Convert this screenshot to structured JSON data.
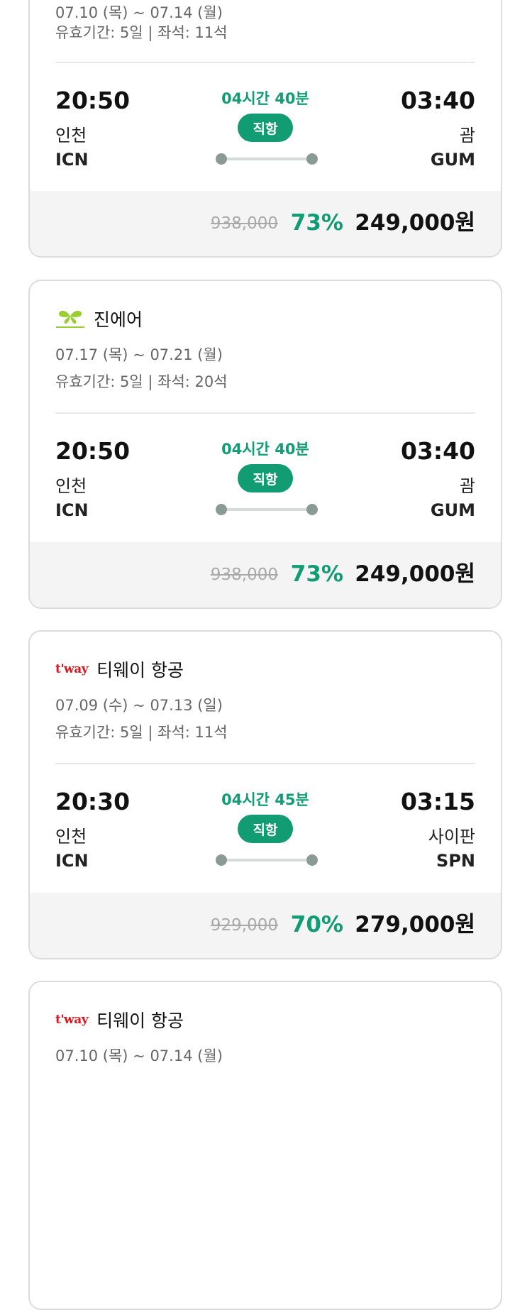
{
  "cards": [
    {
      "airline": "",
      "dates": "07.10 (목) ~ 07.14 (월)",
      "validity": "유효기간: 5일 | 좌석: 11석",
      "departure": {
        "time": "20:50",
        "city": "인천",
        "code": "ICN"
      },
      "arrival": {
        "time": "03:40",
        "city": "괌",
        "code": "GUM"
      },
      "duration": "04시간 40분",
      "flight_type": "직항",
      "original_price": "938,000",
      "discount": "73%",
      "price": "249,000원"
    },
    {
      "airline": "진에어",
      "logo": "jinair-logo",
      "dates": "07.17 (목) ~ 07.21 (월)",
      "validity": "유효기간: 5일 | 좌석: 20석",
      "departure": {
        "time": "20:50",
        "city": "인천",
        "code": "ICN"
      },
      "arrival": {
        "time": "03:40",
        "city": "괌",
        "code": "GUM"
      },
      "duration": "04시간 40분",
      "flight_type": "직항",
      "original_price": "938,000",
      "discount": "73%",
      "price": "249,000원"
    },
    {
      "airline": "티웨이 항공",
      "logo": "tway-logo",
      "logo_text": "t'way",
      "dates": "07.09 (수) ~ 07.13 (일)",
      "validity": "유효기간: 5일 | 좌석: 11석",
      "departure": {
        "time": "20:30",
        "city": "인천",
        "code": "ICN"
      },
      "arrival": {
        "time": "03:15",
        "city": "사이판",
        "code": "SPN"
      },
      "duration": "04시간 45분",
      "flight_type": "직항",
      "original_price": "929,000",
      "discount": "70%",
      "price": "279,000원"
    },
    {
      "airline": "티웨이 항공",
      "logo": "tway-logo",
      "logo_text": "t'way",
      "dates": "07.10 (목) ~ 07.14 (월)"
    }
  ],
  "colors": {
    "accent": "#129c74",
    "jinair_green": "#9acd32",
    "tway_red": "#d7191f",
    "price_bg": "#f4f4f4",
    "strike_text": "#a9a9a9"
  }
}
